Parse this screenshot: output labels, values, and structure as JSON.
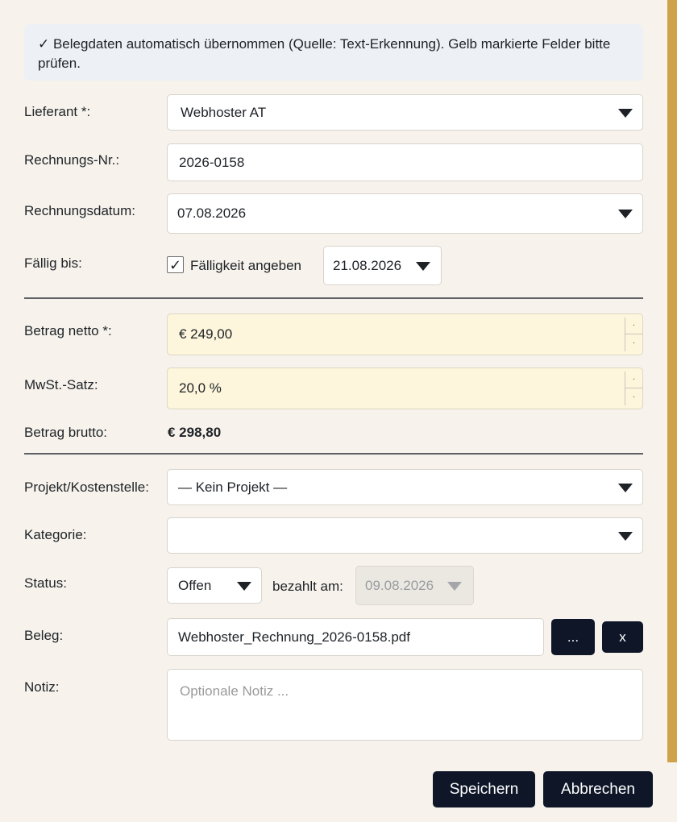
{
  "banner": {
    "text": "✓ Belegdaten automatisch übernommen (Quelle: Text-Erkennung). Gelb markierte Felder bitte prüfen."
  },
  "form": {
    "supplier": {
      "label": "Lieferant *:",
      "value": "Webhoster AT"
    },
    "invoice_no": {
      "label": "Rechnungs-Nr.:",
      "value": "2026-0158"
    },
    "invoice_date": {
      "label": "Rechnungsdatum:",
      "value": "07.08.2026"
    },
    "due": {
      "label": "Fällig bis:",
      "checkbox_label": "Fälligkeit angeben",
      "checkbox_mark": "✓",
      "checked": true,
      "value": "21.08.2026"
    },
    "net_amount": {
      "label": "Betrag netto *:",
      "value": "€ 249,00"
    },
    "vat_rate": {
      "label": "MwSt.-Satz:",
      "value": "20,0 %"
    },
    "gross_amount": {
      "label": "Betrag brutto:",
      "value": "€ 298,80"
    },
    "project": {
      "label": "Projekt/Kostenstelle:",
      "value": "— Kein Projekt —"
    },
    "category": {
      "label": "Kategorie:",
      "value": ""
    },
    "status": {
      "label": "Status:",
      "value": "Offen",
      "paid_label": "bezahlt am:",
      "paid_value": "09.08.2026"
    },
    "receipt": {
      "label": "Beleg:",
      "value": "Webhoster_Rechnung_2026-0158.pdf",
      "browse_label": "...",
      "clear_label": "x"
    },
    "note": {
      "label": "Notiz:",
      "placeholder": "Optionale Notiz ..."
    }
  },
  "actions": {
    "save_label": "Speichern",
    "cancel_label": "Abbrechen"
  },
  "colors": {
    "background": "#f7f3ec",
    "banner": "#edf0f5",
    "highlight": "#fdf6dc",
    "dark_button": "#0e1628",
    "scroll_accent": "#cfa24a"
  }
}
